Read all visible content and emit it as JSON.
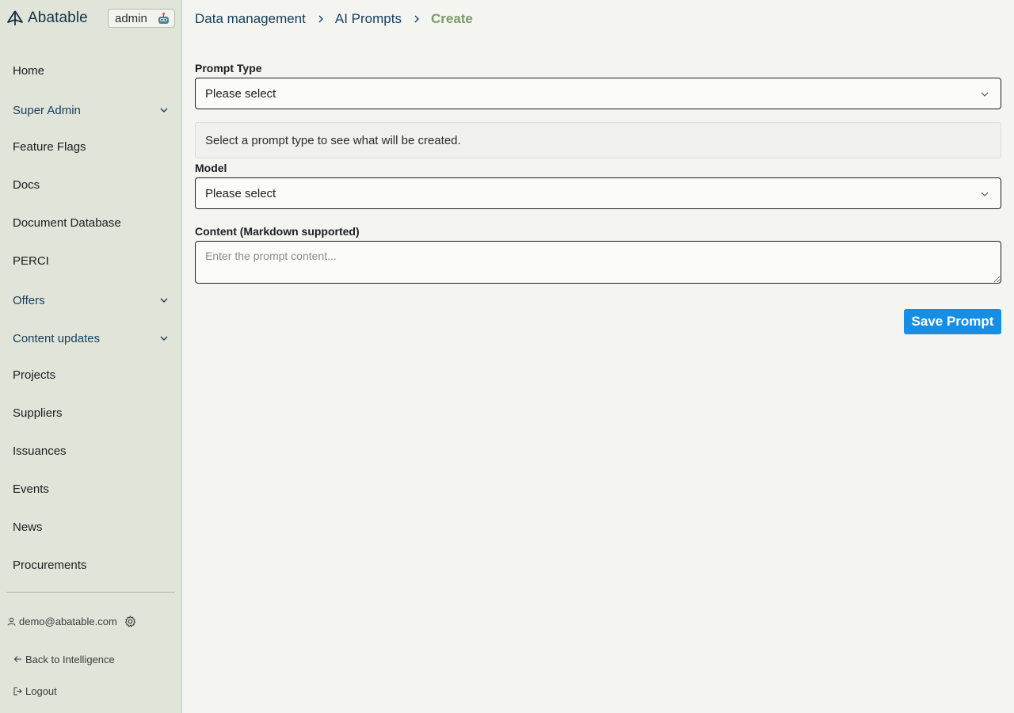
{
  "brand": {
    "name": "Abatable",
    "logo_icon": "sail-logo-icon",
    "role": "admin",
    "role_icon": "robot-icon"
  },
  "sidebar": {
    "items": [
      {
        "label": "Home",
        "expandable": false
      },
      {
        "label": "Super Admin",
        "expandable": true
      },
      {
        "label": "Feature Flags",
        "expandable": false
      },
      {
        "label": "Docs",
        "expandable": false
      },
      {
        "label": "Document Database",
        "expandable": false
      },
      {
        "label": "PERCI",
        "expandable": false
      },
      {
        "label": "Offers",
        "expandable": true
      },
      {
        "label": "Content updates",
        "expandable": true
      },
      {
        "label": "Projects",
        "expandable": false
      },
      {
        "label": "Suppliers",
        "expandable": false
      },
      {
        "label": "Issuances",
        "expandable": false
      },
      {
        "label": "Events",
        "expandable": false
      },
      {
        "label": "News",
        "expandable": false
      },
      {
        "label": "Procurements",
        "expandable": false
      }
    ],
    "footer": {
      "user_email": "demo@abatable.com",
      "back_label": "Back to Intelligence",
      "logout_label": "Logout"
    }
  },
  "breadcrumb": [
    "Data management",
    "AI Prompts",
    "Create"
  ],
  "form": {
    "prompt_type": {
      "label": "Prompt Type",
      "value": "Please select"
    },
    "info_text": "Select a prompt type to see what will be created.",
    "model": {
      "label": "Model",
      "value": "Please select"
    },
    "content": {
      "label": "Content (Markdown supported)",
      "placeholder": "Enter the prompt content..."
    },
    "save_label": "Save Prompt"
  },
  "colors": {
    "accent": "#168ee6",
    "brand": "#123446",
    "active_crumb": "#7b9a6c",
    "sidebar_bg": "#e1e4d9"
  }
}
